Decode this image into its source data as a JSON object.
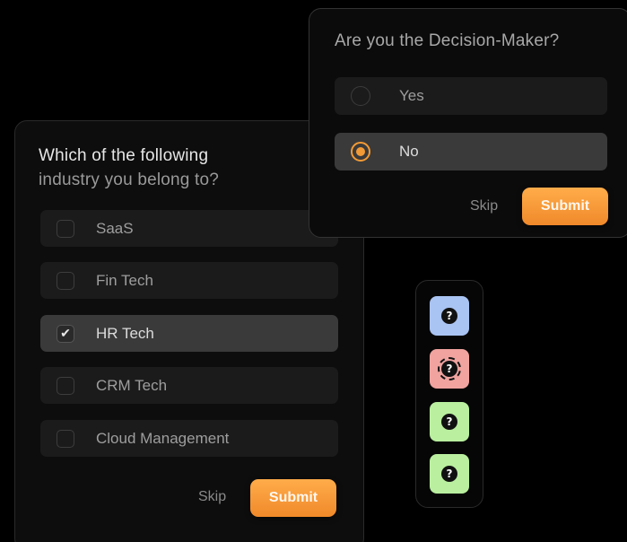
{
  "industry_card": {
    "title_line1": "Which of the following",
    "title_line2": "industry you belong to?",
    "options": [
      {
        "label": "SaaS",
        "checked": false
      },
      {
        "label": "Fin Tech",
        "checked": false
      },
      {
        "label": "HR Tech",
        "checked": true
      },
      {
        "label": "CRM Tech",
        "checked": false
      },
      {
        "label": "Cloud Management",
        "checked": false
      }
    ],
    "skip_label": "Skip",
    "submit_label": "Submit"
  },
  "decision_card": {
    "title": "Are you the Decision-Maker?",
    "options": [
      {
        "label": "Yes",
        "selected": false
      },
      {
        "label": "No",
        "selected": true
      }
    ],
    "skip_label": "Skip",
    "submit_label": "Submit"
  },
  "status_panel": {
    "tiles": [
      {
        "icon": "question-icon",
        "glyph": "?",
        "color": "#a9c3f2"
      },
      {
        "icon": "question-icon",
        "glyph": "?",
        "color": "#f0a39f"
      },
      {
        "icon": "question-icon",
        "glyph": "?",
        "color": "#b9ef9f"
      },
      {
        "icon": "question-icon",
        "glyph": "?",
        "color": "#b9ef9f"
      }
    ]
  },
  "colors": {
    "accent": "#f29a36",
    "background": "#000000"
  }
}
